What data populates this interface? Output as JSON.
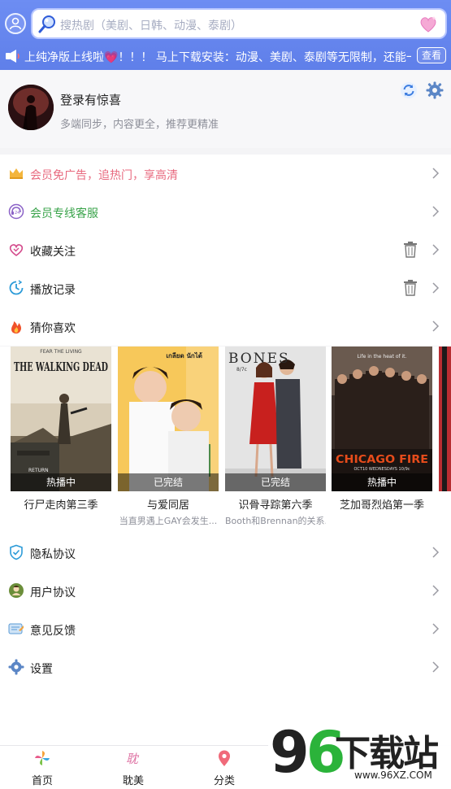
{
  "search": {
    "placeholder": "搜热剧（美剧、日韩、动漫、泰剧）"
  },
  "ticker": {
    "text_pre": "上纯净版上线啦",
    "heart": "💗",
    "text_post": "！！！ 马上下载安装：动漫、美剧、泰剧等无限制，还能一键",
    "view_button": "查看"
  },
  "profile": {
    "title": "登录有惊喜",
    "subtitle": "多端同步，内容更全，推荐更精准"
  },
  "menu": [
    {
      "label": "会员免广告，追热门，享高清",
      "icon": "crown-icon"
    },
    {
      "label": "会员专线客服",
      "icon": "headset-24h-icon"
    },
    {
      "label": "收藏关注",
      "icon": "heart-icon"
    },
    {
      "label": "播放记录",
      "icon": "clock-icon"
    },
    {
      "label": "猜你喜欢",
      "icon": "fire-icon"
    }
  ],
  "posters": [
    {
      "badge": "热播中",
      "title": "行尸走肉第三季",
      "desc": ""
    },
    {
      "badge": "已完结",
      "title": "与爱同居",
      "desc": "当直男遇上GAY会发生..."
    },
    {
      "badge": "已完结",
      "title": "识骨寻踪第六季",
      "desc": "Booth和Brennan的关系..."
    },
    {
      "badge": "热播中",
      "title": "芝加哥烈焰第一季",
      "desc": ""
    }
  ],
  "poster_art": {
    "walking_dead_top": "FEAR THE LIVING",
    "walking_dead_title": "THE WALKING DEAD",
    "walking_dead_tag": "RETURN",
    "bones_title": "BONES",
    "bones_time": "8/7c",
    "chicago_top": "Life in the heat of it.",
    "chicago_title": "CHICAGO FIRE",
    "chicago_date": "OCT10 WEDNESDAYS 10/9c",
    "thai_text": "เกลียด นักได้"
  },
  "menu2": [
    {
      "label": "隐私协议",
      "icon": "shield-check-icon"
    },
    {
      "label": "用户协议",
      "icon": "user-agreement-icon"
    },
    {
      "label": "意见反馈",
      "icon": "feedback-icon"
    },
    {
      "label": "设置",
      "icon": "gear-icon"
    }
  ],
  "tabs": [
    {
      "label": "首页",
      "icon": "pinwheel-icon"
    },
    {
      "label": "耽美",
      "icon": "danmei-icon"
    },
    {
      "label": "分类",
      "icon": "location-pin-icon"
    }
  ],
  "watermark": {
    "logo_9": "9",
    "logo_6": "6",
    "brand": "下载站",
    "url": "www.96XZ.COM"
  },
  "colors": {
    "header_blue": "#6d8df3",
    "vip_pink": "#e86a7f",
    "service_green": "#39a34a",
    "brand_green": "#2bb33a"
  }
}
